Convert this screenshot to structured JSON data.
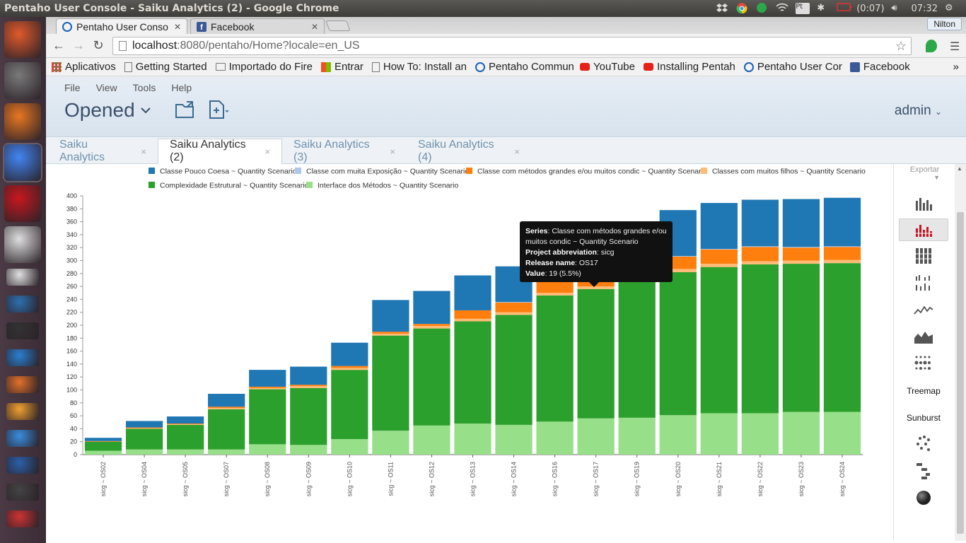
{
  "os": {
    "window_title": "Pentaho User Console - Saiku Analytics (2) - Google Chrome",
    "battery": "(0:07)",
    "clock": "07:32",
    "user_chip": "Nilton"
  },
  "launcher": {
    "apps": [
      "ubuntu-dash-icon",
      "file-cabinet-icon",
      "firefox-icon",
      "chrome-icon",
      "pdf-reader-icon",
      "app-icon",
      "text-editor-icon",
      "workbench-icon",
      "terminal-icon",
      "spreadsheet-icon",
      "software-center-icon",
      "amazon-icon",
      "upload-icon",
      "keepass-icon",
      "monitor-icon",
      "gmail-icon"
    ]
  },
  "browser": {
    "tabs": [
      {
        "label": "Pentaho User Conso",
        "active": true,
        "icon": "pentaho-icon"
      },
      {
        "label": "Facebook",
        "active": false,
        "icon": "facebook-icon"
      }
    ],
    "url_host": "localhost",
    "url_rest": ":8080/pentaho/Home?locale=en_US",
    "bookmarks": [
      {
        "label": "Aplicativos",
        "icon": "apps-icon"
      },
      {
        "label": "Getting Started",
        "icon": "page-icon"
      },
      {
        "label": "Importado do Fire",
        "icon": "folder-icon"
      },
      {
        "label": "Entrar",
        "icon": "microsoft-icon"
      },
      {
        "label": "How To: Install an",
        "icon": "page-icon"
      },
      {
        "label": "Pentaho Commun",
        "icon": "pentaho-icon"
      },
      {
        "label": "YouTube",
        "icon": "youtube-icon"
      },
      {
        "label": "Installing Pentah",
        "icon": "youtube-icon"
      },
      {
        "label": "Pentaho User Cor",
        "icon": "pentaho-icon"
      },
      {
        "label": "Facebook",
        "icon": "facebook-icon"
      }
    ],
    "more": "»"
  },
  "puc": {
    "menu": [
      "File",
      "View",
      "Tools",
      "Help"
    ],
    "perspective": "Opened",
    "user": "admin",
    "content_tabs": [
      {
        "label": "Saiku Analytics",
        "active": false
      },
      {
        "label": "Saiku Analytics (2)",
        "active": true
      },
      {
        "label": "Saiku Analytics (3)",
        "active": false
      },
      {
        "label": "Saiku Analytics (4)",
        "active": false
      }
    ],
    "tab_close": "×"
  },
  "sidebar": {
    "export_label": "Exportar",
    "items": [
      {
        "name": "bar-chart-icon",
        "label": ""
      },
      {
        "name": "stacked-bar-chart-icon",
        "label": "",
        "active": true
      },
      {
        "name": "stacked-100-chart-icon",
        "label": ""
      },
      {
        "name": "multi-bar-chart-icon",
        "label": ""
      },
      {
        "name": "line-chart-icon",
        "label": ""
      },
      {
        "name": "area-chart-icon",
        "label": ""
      },
      {
        "name": "heatgrid-icon",
        "label": ""
      },
      {
        "name": "treemap-button",
        "label": "Treemap"
      },
      {
        "name": "sunburst-button",
        "label": "Sunburst"
      },
      {
        "name": "dot-chart-icon",
        "label": ""
      },
      {
        "name": "waterfall-icon",
        "label": ""
      },
      {
        "name": "sphere-icon",
        "label": ""
      }
    ]
  },
  "tooltip": {
    "series_label": "Series",
    "series_value": ": Classe com métodos grandes e/ou muitos condic ~ Quantity Scenario",
    "project_label": "Project abbreviation",
    "project_value": ": sicg",
    "release_label": "Release name",
    "release_value": ": OS17",
    "value_label": "Value",
    "value_value": ": 19 (5.5%)"
  },
  "chart_data": {
    "type": "bar",
    "stacked": true,
    "legend_position": "top",
    "ylim": [
      0,
      400
    ],
    "y_ticks": [
      0,
      20,
      40,
      60,
      80,
      100,
      120,
      140,
      160,
      180,
      200,
      220,
      240,
      260,
      280,
      300,
      320,
      340,
      360,
      380,
      400
    ],
    "categories": [
      "sicg ~ OS02",
      "sicg ~ OS04",
      "sicg ~ OS05",
      "sicg ~ OS07",
      "sicg ~ OS08",
      "sicg ~ OS09",
      "sicg ~ OS10",
      "sicg ~ OS11",
      "sicg ~ OS12",
      "sicg ~ OS13",
      "sicg ~ OS14",
      "sicg ~ OS16",
      "sicg ~ OS17",
      "sicg ~ OS19",
      "sicg ~ OS20",
      "sicg ~ OS21",
      "sicg ~ OS22",
      "sicg ~ OS23",
      "sicg ~ OS24"
    ],
    "series": [
      {
        "name": "Interface dos Métodos ~ Quantity Scenario",
        "color": "#98df8a",
        "values": [
          6,
          8,
          8,
          8,
          16,
          15,
          24,
          37,
          45,
          48,
          46,
          51,
          56,
          57,
          61,
          64,
          64,
          66,
          66
        ]
      },
      {
        "name": "Complexidade Estrutural ~ Quantity Scenario",
        "color": "#2ca02c",
        "values": [
          14,
          32,
          38,
          62,
          85,
          88,
          107,
          147,
          150,
          158,
          170,
          195,
          200,
          212,
          221,
          226,
          230,
          229,
          230
        ]
      },
      {
        "name": "Classes com muitos filhos ~ Quantity Scenario",
        "color": "#ffbb78",
        "values": [
          0,
          1,
          1,
          2,
          2,
          3,
          3,
          3,
          4,
          4,
          4,
          4,
          4,
          4,
          5,
          5,
          5,
          5,
          5
        ]
      },
      {
        "name": "Classe com métodos grandes e/ou muitos condic ~ Quantity Scenario",
        "color": "#ff7f0e",
        "values": [
          1,
          1,
          1,
          2,
          2,
          2,
          3,
          3,
          3,
          13,
          15,
          18,
          19,
          19,
          19,
          22,
          22,
          20,
          20
        ]
      },
      {
        "name": "Classe com muita Exposição ~ Quantity Scenario",
        "color": "#aec7e8",
        "values": [
          0,
          0,
          0,
          0,
          0,
          0,
          0,
          0,
          0,
          0,
          1,
          1,
          1,
          1,
          1,
          1,
          1,
          1,
          1
        ]
      },
      {
        "name": "Classe Pouco Coesa ~ Quantity Scenario",
        "color": "#1f77b4",
        "values": [
          5,
          10,
          11,
          20,
          26,
          28,
          36,
          49,
          51,
          54,
          55,
          60,
          63,
          66,
          71,
          71,
          72,
          74,
          75
        ]
      }
    ],
    "legend_order": [
      "Classe Pouco Coesa ~ Quantity Scenario",
      "Classe com muita Exposição ~ Quantity Scenario",
      "Classe com métodos grandes e/ou muitos condic ~ Quantity Scenario",
      "Classes com muitos filhos ~ Quantity Scenario",
      "Complexidade Estrutural ~ Quantity Scenario",
      "Interface dos Métodos ~ Quantity Scenario"
    ]
  }
}
